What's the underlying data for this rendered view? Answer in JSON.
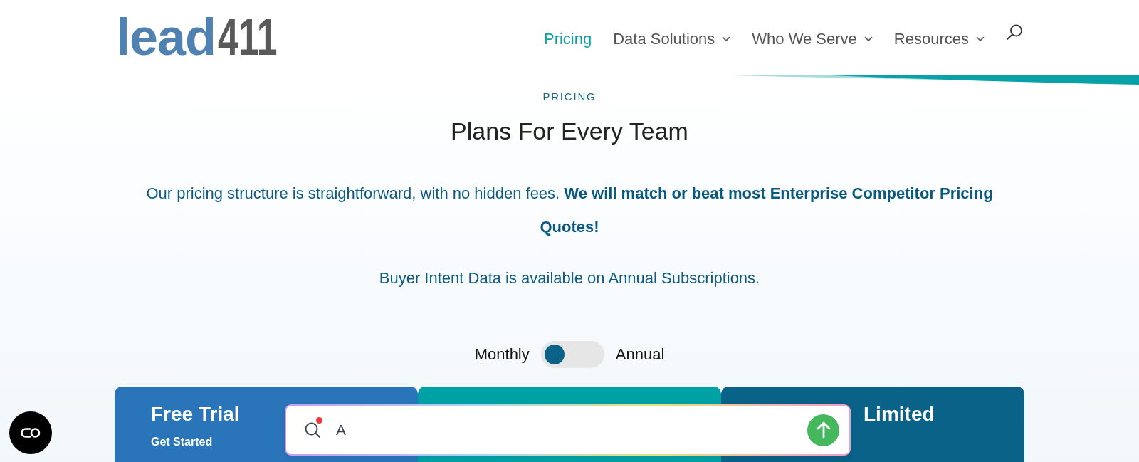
{
  "header": {
    "logo": {
      "text": "lead",
      "accent_text": "411"
    },
    "nav": [
      {
        "label": "Pricing",
        "selected": true,
        "dropdown": false
      },
      {
        "label": "Data Solutions",
        "selected": false,
        "dropdown": true
      },
      {
        "label": "Who We Serve",
        "selected": false,
        "dropdown": true
      },
      {
        "label": "Resources",
        "selected": false,
        "dropdown": true
      }
    ]
  },
  "pricing": {
    "eyebrow": "PRICING",
    "title": "Plans For Every Team",
    "intro": "Our pricing structure is straightforward, with no hidden fees. **We will match or beat most Enterprise Competitor Pricing Quotes!**",
    "note": "Buyer Intent Data is available on Annual Subscriptions."
  },
  "billing_toggle": {
    "left_label": "Monthly",
    "right_label": "Annual",
    "on": false
  },
  "plans": [
    {
      "title": "Free Trial",
      "subtitle": "Get Started",
      "color": "#2a75b9"
    },
    {
      "color": "#00a1a5"
    },
    {
      "title": "Limited",
      "color": "#0a6289"
    }
  ],
  "assistant_bar": {
    "value": "A"
  }
}
